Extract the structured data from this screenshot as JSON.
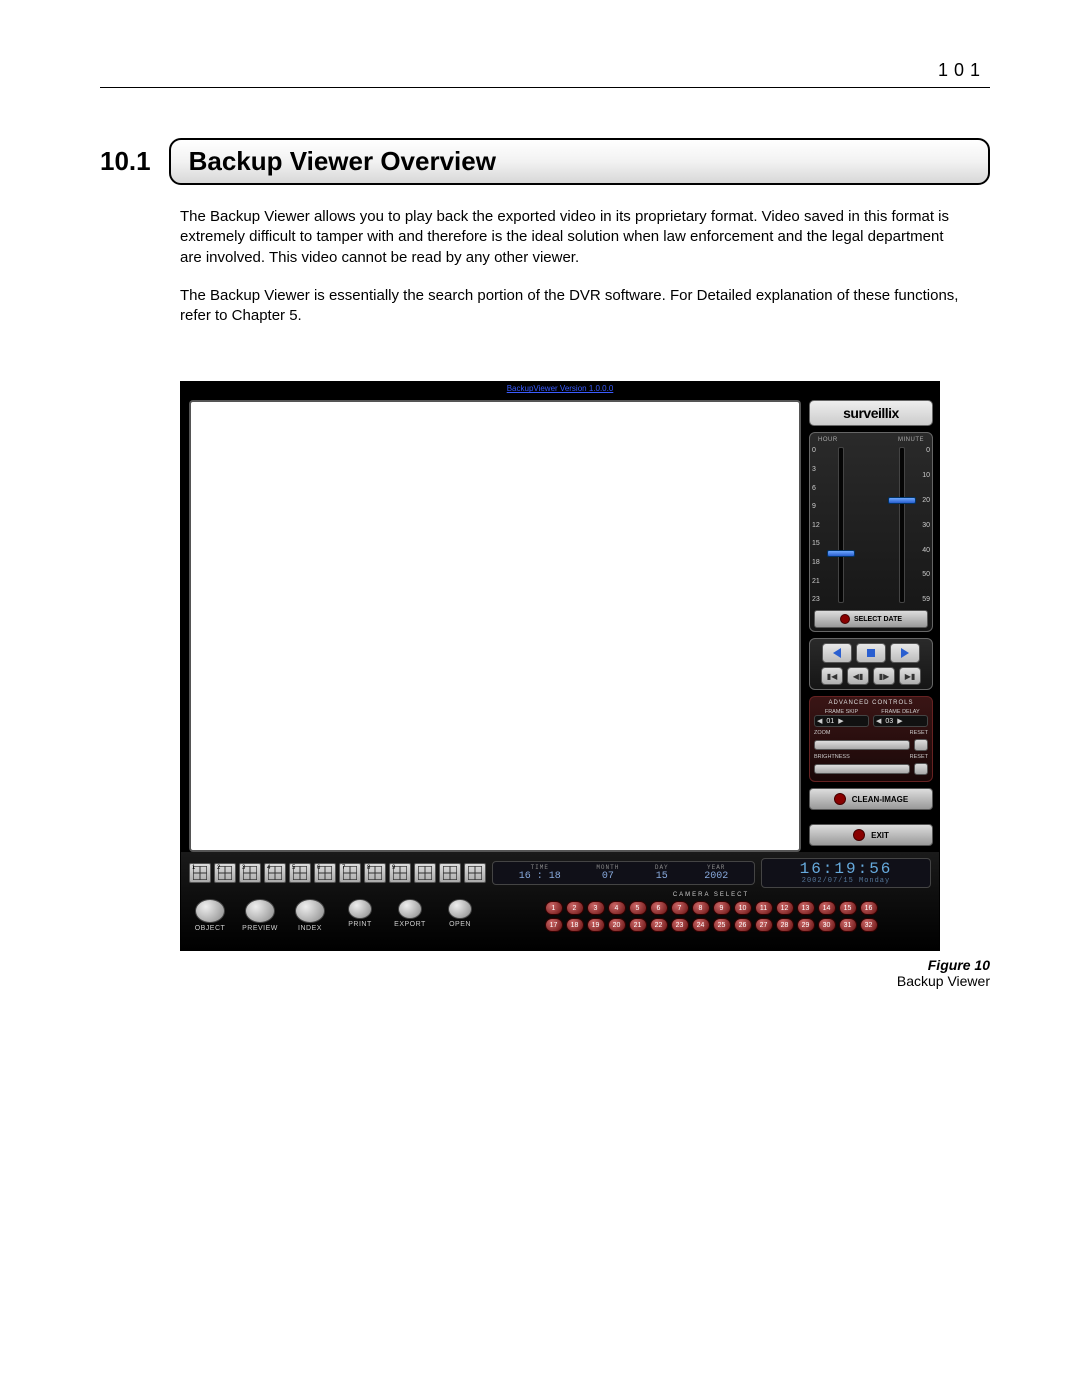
{
  "page_number": "101",
  "section_number": "10.1",
  "section_title": "Backup Viewer Overview",
  "para1": "The Backup Viewer allows you to play back the exported video in its proprietary format. Video saved in this format is extremely difficult to tamper with and therefore is the ideal solution when law enforcement and the legal department are involved. This video cannot be read by any other viewer.",
  "para2": "The Backup Viewer is essentially the search portion of the DVR software. For Detailed explanation of these functions, refer to Chapter 5.",
  "figure_label": "Figure 10",
  "figure_text": "Backup Viewer",
  "app": {
    "title": "BackupViewer Version 1.0.0.0",
    "logo": "surveillix",
    "hour_label": "HOUR",
    "minute_label": "MINUTE",
    "hour_ticks": [
      "0",
      "3",
      "6",
      "9",
      "12",
      "15",
      "18",
      "21",
      "23"
    ],
    "minute_ticks": [
      "0",
      "10",
      "20",
      "30",
      "40",
      "50",
      "59"
    ],
    "select_date": "SELECT DATE",
    "advanced_title": "ADVANCED CONTROLS",
    "frame_skip_label": "FRAME SKIP",
    "frame_delay_label": "FRAME DELAY",
    "frame_skip_val": "01",
    "frame_delay_val": "03",
    "zoom_label": "ZOOM",
    "brightness_label": "BRIGHTNESS",
    "reset_label": "RESET",
    "clean_image": "CLEAN-IMAGE",
    "exit": "EXIT",
    "time_labels": {
      "time": "TIME",
      "month": "MONTH",
      "day": "DAY",
      "year": "YEAR"
    },
    "time_vals": {
      "time": "16 : 18",
      "month": "07",
      "day": "15",
      "year": "2002"
    },
    "clock_big": "16:19:56",
    "clock_sub": "2002/07/15 Monday",
    "obj_buttons": [
      "OBJECT",
      "PREVIEW",
      "INDEX",
      "PRINT",
      "EXPORT",
      "OPEN"
    ],
    "camera_select_label": "CAMERA SELECT",
    "cam_row1": [
      "1",
      "2",
      "3",
      "4",
      "5",
      "6",
      "7",
      "8",
      "9",
      "10",
      "11",
      "12",
      "13",
      "14",
      "15",
      "16"
    ],
    "cam_row2": [
      "17",
      "18",
      "19",
      "20",
      "21",
      "22",
      "23",
      "24",
      "25",
      "26",
      "27",
      "28",
      "29",
      "30",
      "31",
      "32"
    ],
    "grid_nums": [
      "1",
      "2",
      "3",
      "4",
      "5",
      "6",
      "7",
      "8",
      "9",
      "",
      "",
      ""
    ]
  }
}
